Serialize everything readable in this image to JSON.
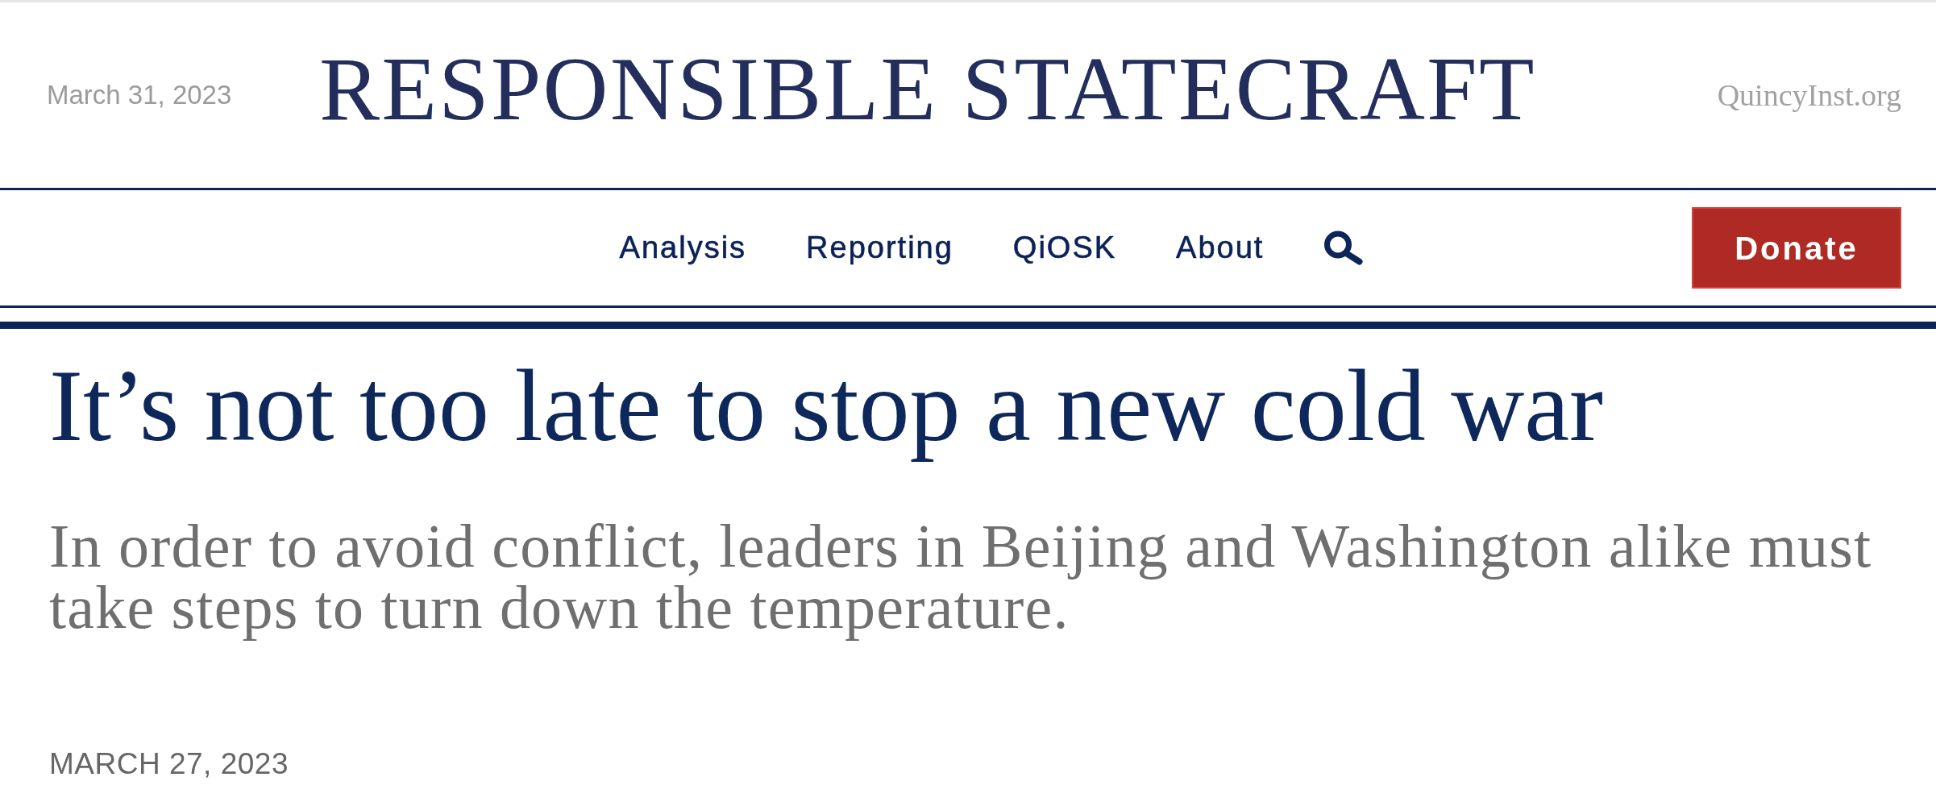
{
  "header": {
    "date": "March 31, 2023",
    "logo": "RESPONSIBLE STATECRAFT",
    "site_link": "QuincyInst.org"
  },
  "nav": {
    "items": [
      "Analysis",
      "Reporting",
      "QiOSK",
      "About"
    ],
    "donate_button": "Donate"
  },
  "article": {
    "headline": "It’s not too late to stop a new cold war",
    "dek": "In order to avoid conflict, leaders in Beijing and Washington alike must take steps to turn down the temperature.",
    "date": "MARCH 27, 2023"
  }
}
